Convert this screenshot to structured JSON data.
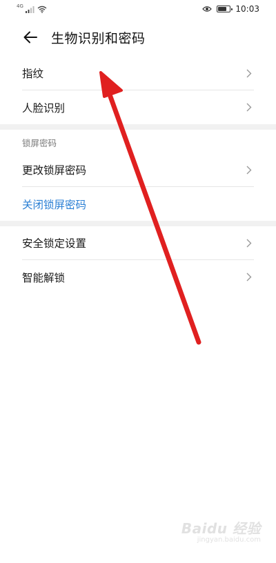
{
  "status_bar": {
    "network_type": "4G",
    "time": "10:03",
    "battery_level": 0.75,
    "icons": [
      "signal-icon",
      "wifi-icon",
      "eye-icon",
      "battery-icon"
    ]
  },
  "header": {
    "title": "生物识别和密码",
    "back_icon": "arrow-left-icon"
  },
  "group1": {
    "items": [
      {
        "label": "指纹"
      },
      {
        "label": "人脸识别"
      }
    ]
  },
  "group2": {
    "header": "锁屏密码",
    "items": [
      {
        "label": "更改锁屏密码"
      },
      {
        "label": "关闭锁屏密码"
      }
    ]
  },
  "group3": {
    "items": [
      {
        "label": "安全锁定设置"
      },
      {
        "label": "智能解锁"
      }
    ]
  },
  "colors": {
    "accent_blue": "#2a7fd4",
    "annotation_red": "#e02020",
    "divider": "#e6e6e6",
    "section_gap": "#f1f1f1"
  },
  "watermark": {
    "logo": "Baidu 经验",
    "url": "jingyan.baidu.com"
  }
}
